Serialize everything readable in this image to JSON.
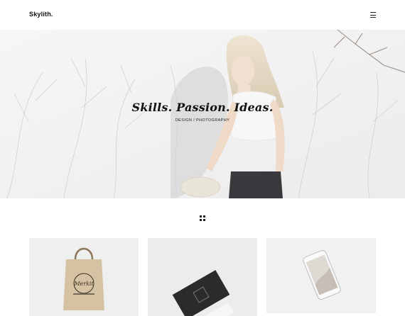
{
  "header": {
    "logo": "Skylith.",
    "menu_icon": "hamburger-menu-icon"
  },
  "hero": {
    "title": "Skills. Passion. Ideas.",
    "subtitle": "DESIGN / PHOTOGRAPHY"
  },
  "filter": {
    "icon": "grid-icon"
  },
  "portfolio": {
    "items": [
      {
        "thumb": "tote-bag-mockup"
      },
      {
        "thumb": "business-card-mockup"
      },
      {
        "thumb": "smartphone-mockup"
      }
    ]
  },
  "colors": {
    "background": "#ffffff",
    "text": "#111111",
    "card": "#efefef"
  }
}
